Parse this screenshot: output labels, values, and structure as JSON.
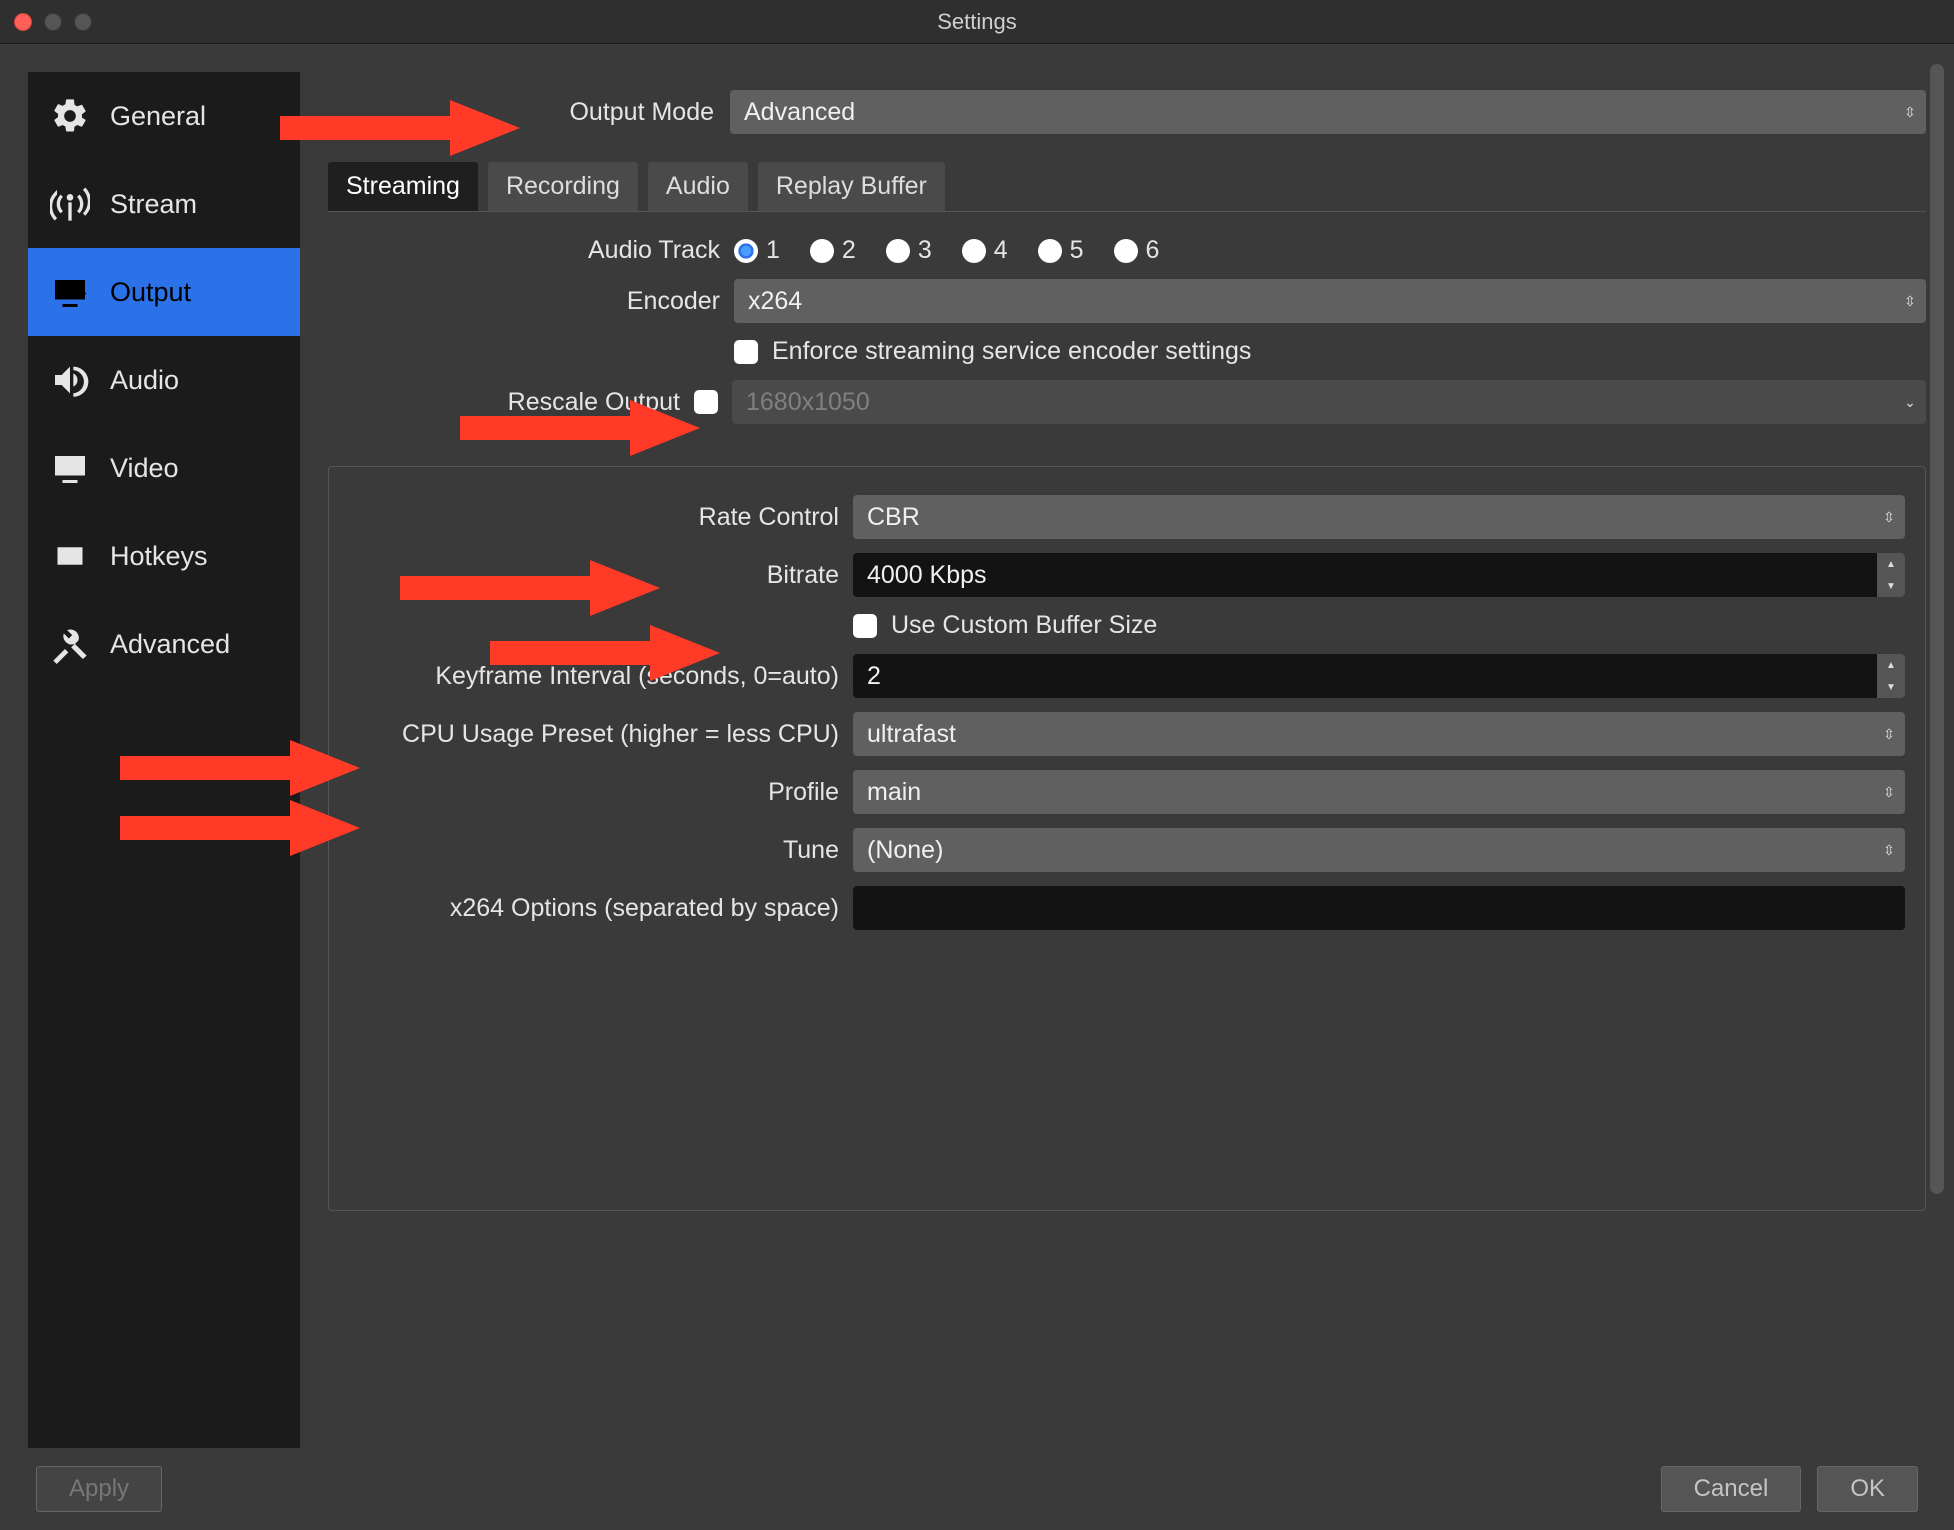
{
  "window": {
    "title": "Settings"
  },
  "sidebar": {
    "items": [
      {
        "label": "General"
      },
      {
        "label": "Stream"
      },
      {
        "label": "Output"
      },
      {
        "label": "Audio"
      },
      {
        "label": "Video"
      },
      {
        "label": "Hotkeys"
      },
      {
        "label": "Advanced"
      }
    ]
  },
  "header": {
    "output_mode_label": "Output Mode",
    "output_mode_value": "Advanced"
  },
  "tabs": {
    "streaming": "Streaming",
    "recording": "Recording",
    "audio": "Audio",
    "replay_buffer": "Replay Buffer"
  },
  "streaming": {
    "audio_track_label": "Audio Track",
    "audio_track_options": [
      "1",
      "2",
      "3",
      "4",
      "5",
      "6"
    ],
    "audio_track_selected": "1",
    "encoder_label": "Encoder",
    "encoder_value": "x264",
    "enforce_label": "Enforce streaming service encoder settings",
    "enforce_checked": false,
    "rescale_label": "Rescale Output",
    "rescale_checked": false,
    "rescale_placeholder": "1680x1050"
  },
  "encoder": {
    "rate_control_label": "Rate Control",
    "rate_control_value": "CBR",
    "bitrate_label": "Bitrate",
    "bitrate_value": "4000 Kbps",
    "custom_buffer_label": "Use Custom Buffer Size",
    "custom_buffer_checked": false,
    "keyframe_label": "Keyframe Interval (seconds, 0=auto)",
    "keyframe_value": "2",
    "cpu_preset_label": "CPU Usage Preset (higher = less CPU)",
    "cpu_preset_value": "ultrafast",
    "profile_label": "Profile",
    "profile_value": "main",
    "tune_label": "Tune",
    "tune_value": "(None)",
    "x264_options_label": "x264 Options (separated by space)",
    "x264_options_value": ""
  },
  "footer": {
    "apply": "Apply",
    "cancel": "Cancel",
    "ok": "OK"
  }
}
